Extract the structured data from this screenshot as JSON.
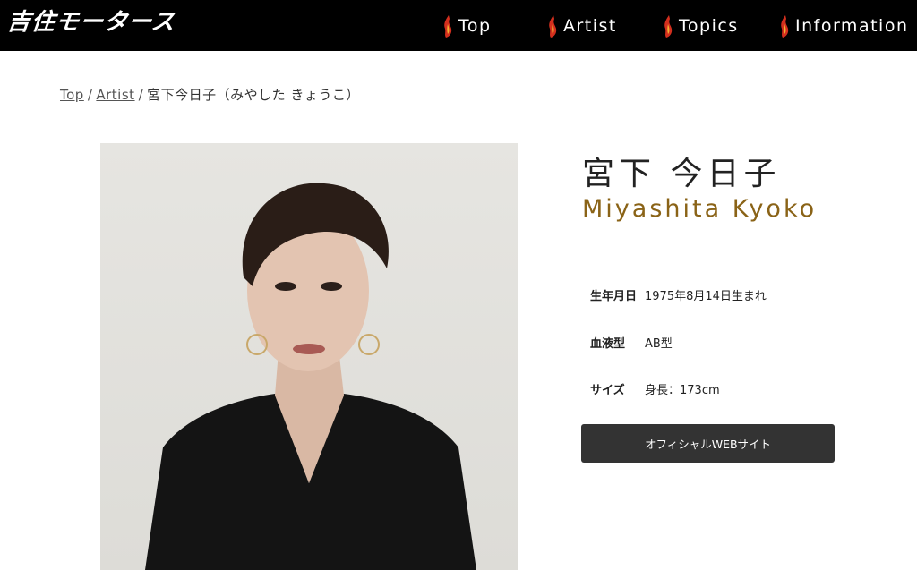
{
  "header": {
    "logo_text": "吉住モータース",
    "nav": [
      {
        "label": "Top"
      },
      {
        "label": "Artist"
      },
      {
        "label": "Topics"
      },
      {
        "label": "Information"
      }
    ],
    "nav_icon": "flame-icon"
  },
  "breadcrumb": {
    "top": "Top",
    "artist": "Artist",
    "current": "宮下今日子（みやした きょうこ）"
  },
  "profile": {
    "name_ja": "宮下 今日子",
    "name_en": "Miyashita Kyoko",
    "rows": [
      {
        "label": "生年月日",
        "value": "1975年8月14日生まれ"
      },
      {
        "label": "血液型",
        "value": "AB型"
      },
      {
        "label": "サイズ",
        "value": "身長：173cm"
      }
    ],
    "official_button": "オフィシャルWEBサイト"
  },
  "colors": {
    "header_bg": "#000000",
    "name_en": "#8a6317",
    "button_bg": "#333333"
  }
}
